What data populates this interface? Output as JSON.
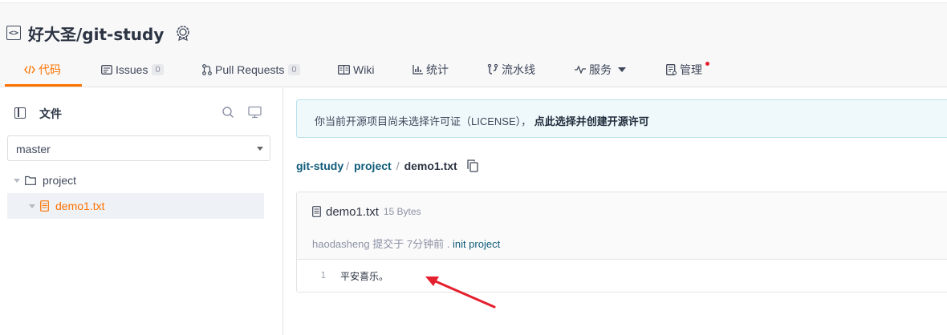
{
  "repo": {
    "title": "好大圣/git-study"
  },
  "tabs": [
    {
      "label": "代码",
      "icon": "code-icon",
      "active": true
    },
    {
      "label": "Issues",
      "count": "0",
      "icon": "issues-icon"
    },
    {
      "label": "Pull Requests",
      "count": "0",
      "icon": "pull-request-icon"
    },
    {
      "label": "Wiki",
      "icon": "wiki-icon"
    },
    {
      "label": "统计",
      "icon": "chart-icon"
    },
    {
      "label": "流水线",
      "icon": "pipeline-icon"
    },
    {
      "label": "服务",
      "icon": "service-icon"
    },
    {
      "label": "管理",
      "icon": "manage-icon"
    }
  ],
  "sidebar": {
    "title": "文件",
    "branch": "master",
    "tree": [
      {
        "label": "project",
        "type": "folder"
      },
      {
        "label": "demo1.txt",
        "type": "file",
        "selected": true
      }
    ]
  },
  "notice": {
    "text": "你当前开源项目尚未选择许可证（LICENSE），",
    "link": "点此选择并创建开源许可"
  },
  "breadcrumb": {
    "repo": "git-study",
    "sep1": "/",
    "folder": "project",
    "sep2": "/",
    "file": "demo1.txt"
  },
  "file": {
    "name": "demo1.txt",
    "size": "15 Bytes",
    "author": "haodasheng",
    "committed": "提交于",
    "time": "7分钟前",
    "dot": ".",
    "commit_msg": "init project",
    "lines": [
      {
        "num": "1",
        "text": "平安喜乐。"
      }
    ]
  },
  "colors": {
    "accent": "#fe7300",
    "link": "#0f5c7a",
    "notice_bg": "#eff9fb",
    "annotation_arrow": "#e5202e"
  }
}
